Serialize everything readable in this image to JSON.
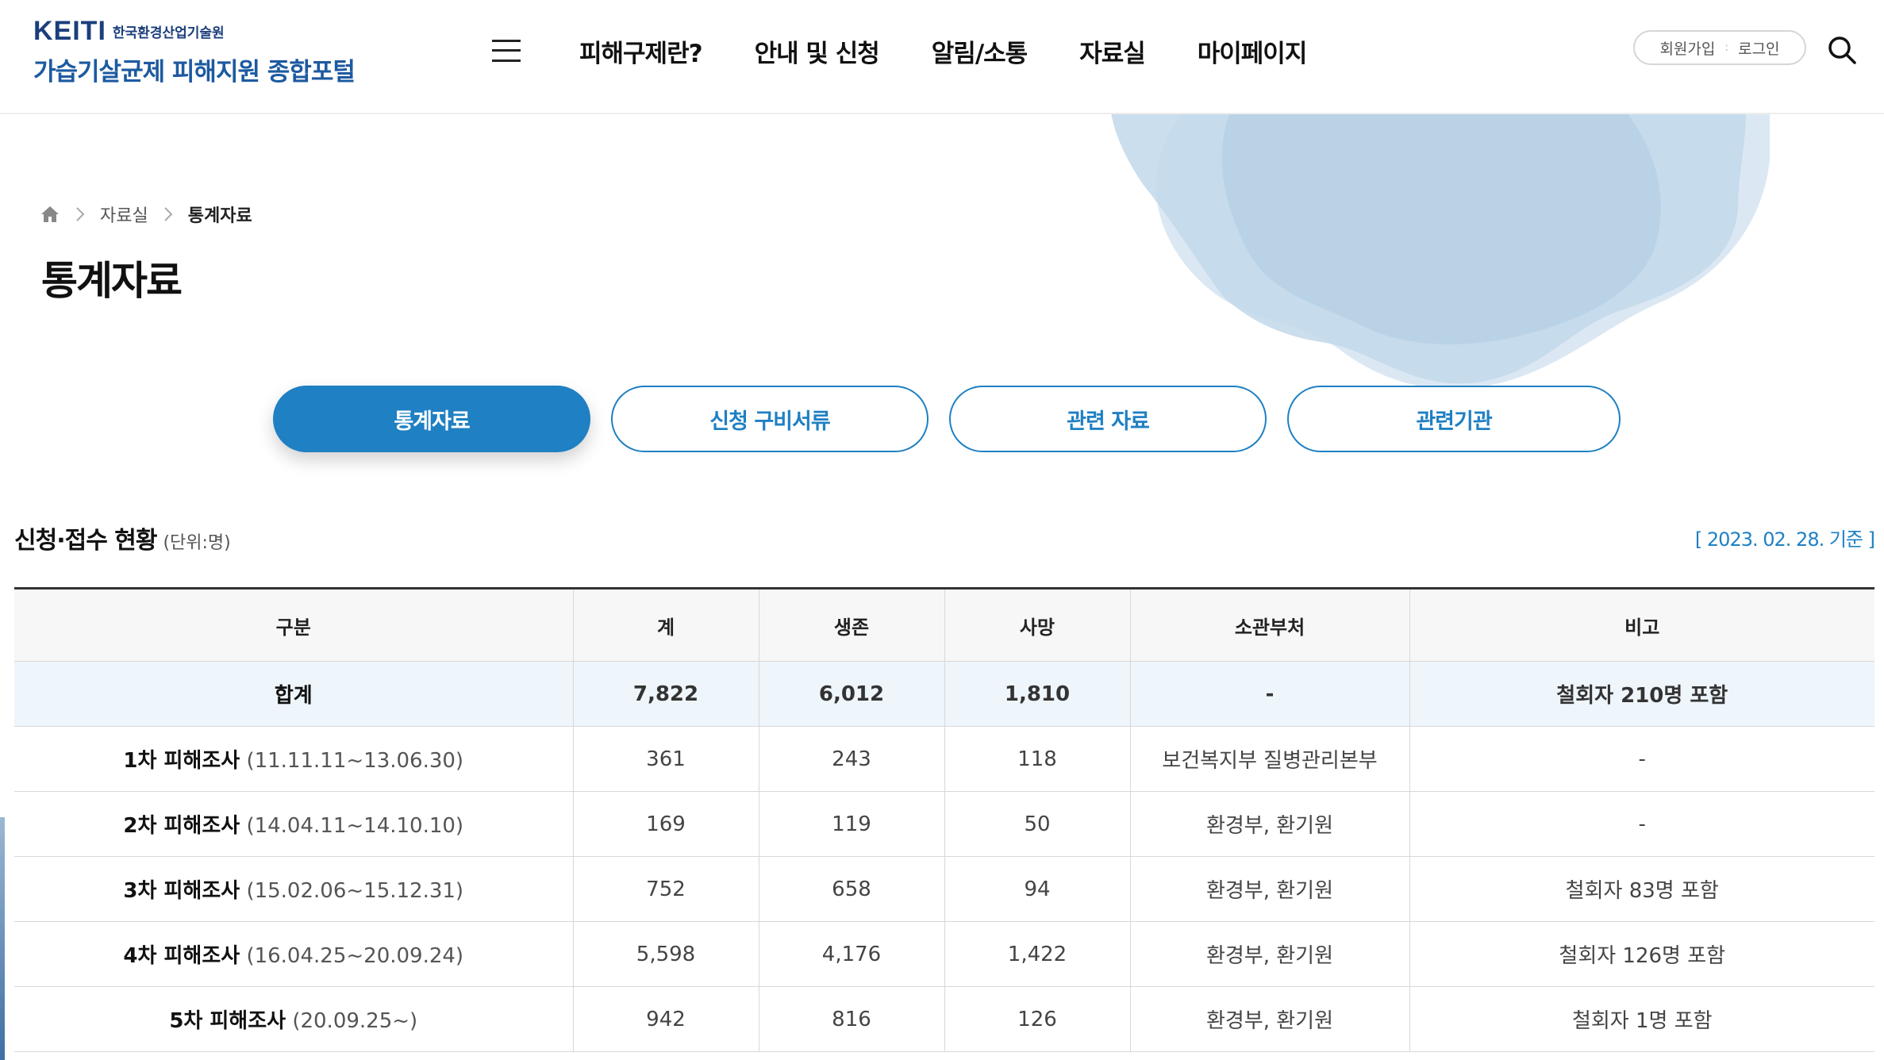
{
  "header": {
    "logo_mark": "KEITI",
    "logo_org": "한국환경산업기술원",
    "logo_title": "가습기살균제 피해지원 종합포털",
    "nav": [
      "피해구제란?",
      "안내 및 신청",
      "알림/소통",
      "자료실",
      "마이페이지"
    ],
    "signup": "회원가입",
    "login": "로그인"
  },
  "breadcrumb": {
    "parent": "자료실",
    "current": "통계자료"
  },
  "page_title": "통계자료",
  "tabs": [
    "통계자료",
    "신청 구비서류",
    "관련 자료",
    "관련기관"
  ],
  "active_tab": 0,
  "section": {
    "title": "신청·접수 현황",
    "unit": "(단위:명)",
    "date": "[ 2023. 02. 28. 기준 ]"
  },
  "table": {
    "headers": [
      "구분",
      "계",
      "생존",
      "사망",
      "소관부처",
      "비고"
    ],
    "total": {
      "name": "합계",
      "total": "7,822",
      "alive": "6,012",
      "dead": "1,810",
      "dept": "-",
      "note": "철회자 210명 포함"
    },
    "rows": [
      {
        "name": "1차 피해조사",
        "period": "(11.11.11~13.06.30)",
        "total": "361",
        "alive": "243",
        "dead": "118",
        "dept": "보건복지부 질병관리본부",
        "note": "-"
      },
      {
        "name": "2차 피해조사",
        "period": "(14.04.11~14.10.10)",
        "total": "169",
        "alive": "119",
        "dead": "50",
        "dept": "환경부, 환기원",
        "note": "-"
      },
      {
        "name": "3차 피해조사",
        "period": "(15.02.06~15.12.31)",
        "total": "752",
        "alive": "658",
        "dead": "94",
        "dept": "환경부, 환기원",
        "note": "철회자 83명 포함"
      },
      {
        "name": "4차 피해조사",
        "period": "(16.04.25~20.09.24)",
        "total": "5,598",
        "alive": "4,176",
        "dead": "1,422",
        "dept": "환경부, 환기원",
        "note": "철회자 126명 포함"
      },
      {
        "name": "5차 피해조사",
        "period": "(20.09.25~)",
        "total": "942",
        "alive": "816",
        "dead": "126",
        "dept": "환경부, 환기원",
        "note": "철회자 1명 포함"
      }
    ]
  },
  "colors": {
    "accent": "#1f80c3",
    "logo": "#1b3f7c",
    "total_row_bg": "#eef5fb",
    "blob_light": "#dbe8f3",
    "blob_dark": "#bcd5e8"
  },
  "icons": [
    "home-icon",
    "chevron-right-icon",
    "hamburger-menu-icon",
    "search-icon"
  ]
}
